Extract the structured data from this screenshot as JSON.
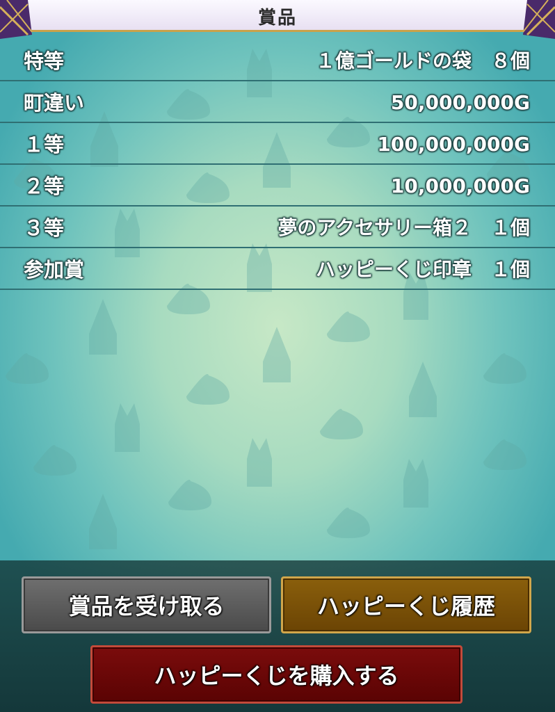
{
  "header": {
    "title": "賞品"
  },
  "prizes": [
    {
      "label": "特等",
      "value": "１億ゴールドの袋　８個"
    },
    {
      "label": "町違い",
      "value": "50,000,000G"
    },
    {
      "label": "１等",
      "value": "100,000,000G"
    },
    {
      "label": "２等",
      "value": "10,000,000G"
    },
    {
      "label": "３等",
      "value": "夢のアクセサリー箱２　１個"
    },
    {
      "label": "参加賞",
      "value": "ハッピーくじ印章　１個"
    }
  ],
  "buttons": {
    "receive_label": "賞品を受け取る",
    "history_label": "ハッピーくじ履歴",
    "buy_label": "ハッピーくじを購入する"
  },
  "colors": {
    "receive_button": "#5a5a5a",
    "history_button": "#7a5208",
    "buy_button": "#6a0808",
    "header_border": "#c9a24a"
  }
}
